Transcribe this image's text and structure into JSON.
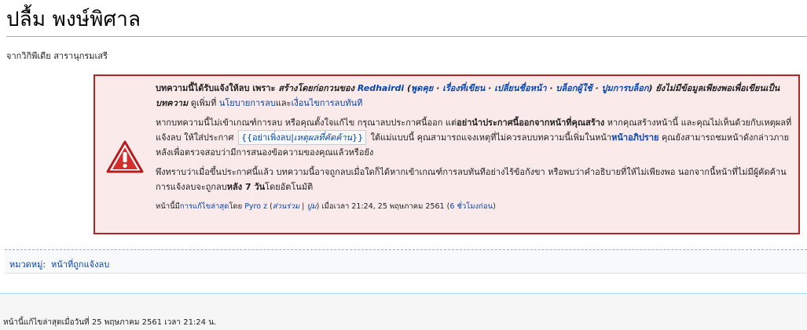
{
  "page": {
    "title": "ปลื้ม พงษ์พิศาล",
    "tagline": "จากวิกิพีเดีย สารานุกรมเสรี"
  },
  "notice": {
    "p1_a": "บทความนี้ได้รับแจ้งให้ลบ เพราะ ",
    "p1_reason": "สร้างโดยก่อกวนของ ",
    "p1_user": "Redhairdi",
    "p1_paren_open": " (",
    "p1_talk": "พูดคุย",
    "p1_sep": " · ",
    "p1_contribs": "เรื่องที่เขียน",
    "p1_rename": "เปลี่ยนชื่อหน้า",
    "p1_blocklog": "บล็อกผู้ใช้",
    "p1_block": "ปูมการบล็อก",
    "p1_paren_close": ") ",
    "p1_b": "ยังไม่มีข้อมูลเพียงพอเพื่อเขียนเป็นบทความ",
    "p1_c": " ดูเพิ่มที่ ",
    "p1_policy": "นโยบายการลบ",
    "p1_and": "และ",
    "p1_speedy": "เงื่อนไขการลบทันที",
    "p2_a": "หากบทความนี้ไม่เข้าเกณฑ์การลบ หรือคุณตั้งใจแก้ไข กรุณาลบประกาศนี้ออก แต่",
    "p2_b": "อย่านำประกาศนี้ออกจากหน้าที่คุณสร้าง",
    "p2_c": " หากคุณสร้างหน้านี้ และคุณไม่เห็นด้วยกับเหตุผลที่แจ้งลบ ให้ใส่ประกาศ ",
    "p2_code_open": "{{",
    "p2_code_link": "อย่าเพิ่งลบ",
    "p2_code_pipe": "|",
    "p2_code_it": "เหตุผลที่คัดค้าน",
    "p2_code_close": "}}",
    "p2_d": " ใต้แม่แบบนี้ คุณสามารถแจงเหตุที่ไม่ควรลบบทความนี้เพิ่มในหน้า",
    "p2_talk": "หน้าอภิปราย",
    "p2_e": " คุณยังสามารถชมหน้าดังกล่าวภายหลังเพื่อตรวจสอบว่ามีการสนองข้อความของคุณแล้วหรือยัง",
    "p3_a": "พึงทราบว่าเมื่อขึ้นประกาศนี้แล้ว บทความนี้อาจถูกลบเมื่อใดก็ได้หากเข้าเกณฑ์การลบทันทีอย่างไร้ข้อกังขา หรือพบว่าคำอธิบายที่ให้ไม่เพียงพอ นอกจากนี้หน้าที่ไม่มีผู้คัดค้านการแจ้งลบจะถูกลบ",
    "p3_b": "หลัง 7 วัน",
    "p3_c": "โดยอัตโนมัติ",
    "p4_a": "หน้านี้มี",
    "p4_edit": "การแก้ไขล่าสุด",
    "p4_by": "โดย ",
    "p4_user": "Pyro z",
    "p4_paren_open": " (",
    "p4_contribs": "ส่วนร่วม",
    "p4_bar": " | ",
    "p4_log": "ปูม",
    "p4_paren_close": ")",
    "p4_time": " เมื่อเวลา 21:24, 25 พฤษภาคม 2561 (",
    "p4_ago": "6 ชั่วโมงก่อน",
    "p4_end": ")"
  },
  "categories": {
    "label": "หมวดหมู่",
    "colon": ":",
    "items": [
      "หน้าที่ถูกแจ้งลบ"
    ]
  },
  "footer": {
    "lastmod": "หน้านี้แก้ไขล่าสุดเมื่อวันที่ 25 พฤษภาคม 2561 เวลา 21:24 น."
  },
  "colors": {
    "link": "#0645ad",
    "notice_bg": "#fbeaea",
    "notice_border": "#b32424",
    "icon_red": "#d33"
  },
  "icons": {
    "notice": "warning-triangle-icon"
  }
}
